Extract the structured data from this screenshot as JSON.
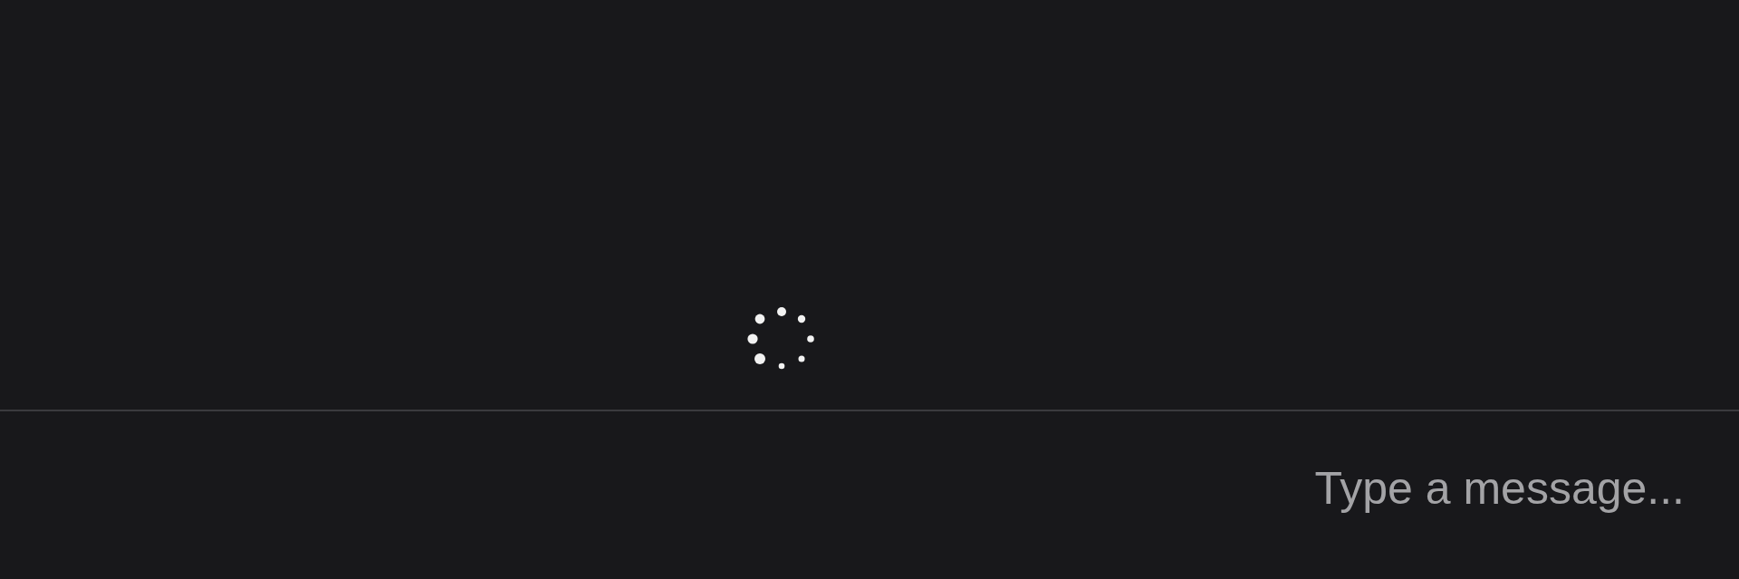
{
  "feed": {
    "loading": true
  },
  "composer": {
    "placeholder": "Type a message..."
  }
}
